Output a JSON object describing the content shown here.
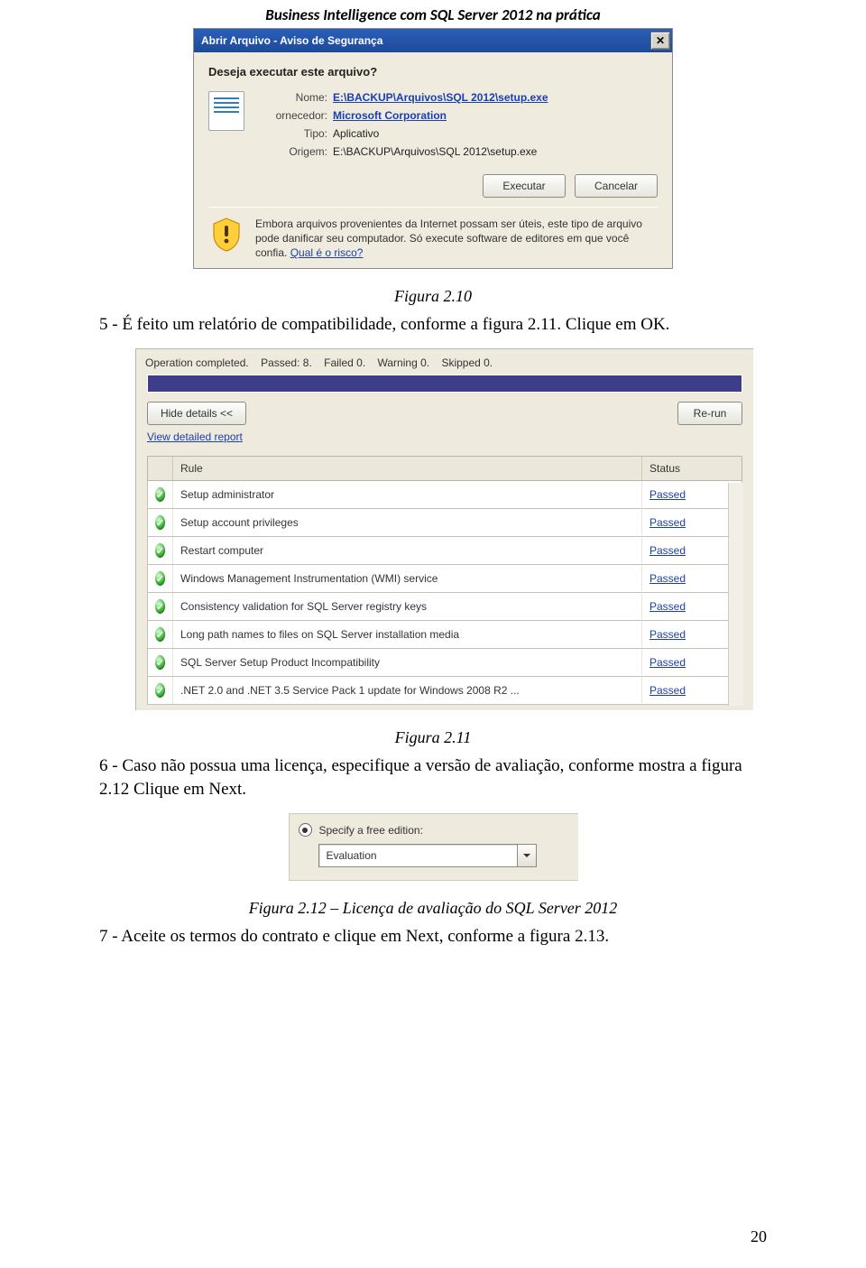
{
  "doc": {
    "header": "Business Intelligence com SQL Server 2012 na prática",
    "page_number": "20"
  },
  "dialog1": {
    "title": "Abrir Arquivo - Aviso de Segurança",
    "question": "Deseja executar este arquivo?",
    "labels": {
      "name": "Nome:",
      "publisher": "ornecedor:",
      "type": "Tipo:",
      "origin": "Origem:"
    },
    "values": {
      "name": "E:\\BACKUP\\Arquivos\\SQL 2012\\setup.exe",
      "publisher": "Microsoft Corporation",
      "type": "Aplicativo",
      "origin": "E:\\BACKUP\\Arquivos\\SQL 2012\\setup.exe"
    },
    "buttons": {
      "run": "Executar",
      "cancel": "Cancelar"
    },
    "warning": "Embora arquivos provenientes da Internet possam ser úteis, este tipo de arquivo pode danificar seu computador. Só execute software de editores em que você confia. ",
    "risk_link": "Qual é o risco?"
  },
  "captions": {
    "fig210": "Figura 2.10",
    "fig211": "Figura 2.11",
    "fig212": "Figura 2.12 – Licença de avaliação do SQL Server 2012"
  },
  "body": {
    "p5": "5 - É feito um relatório de compatibilidade, conforme a figura 2.11. Clique em OK.",
    "p6": "6 - Caso não possua uma licença, especifique a versão de avaliação, conforme mostra a figura 2.12 Clique em Next.",
    "p7": "7 - Aceite os termos do contrato e clique em Next, conforme a figura 2.13."
  },
  "installer": {
    "op_prefix": "Operation completed.",
    "passed": "Passed: 8.",
    "failed": "Failed 0.",
    "warning": "Warning 0.",
    "skipped": "Skipped 0.",
    "hide_details": "Hide details <<",
    "rerun": "Re-run",
    "view_report": "View detailed report",
    "headers": {
      "rule": "Rule",
      "status": "Status"
    },
    "status_passed": "Passed",
    "rules": [
      "Setup administrator",
      "Setup account privileges",
      "Restart computer",
      "Windows Management Instrumentation (WMI) service",
      "Consistency validation for SQL Server registry keys",
      "Long path names to files on SQL Server installation media",
      "SQL Server Setup Product Incompatibility",
      ".NET 2.0 and .NET 3.5 Service Pack 1 update for Windows 2008 R2 ..."
    ]
  },
  "free_edition": {
    "label": "Specify a free edition:",
    "selected": "Evaluation"
  }
}
